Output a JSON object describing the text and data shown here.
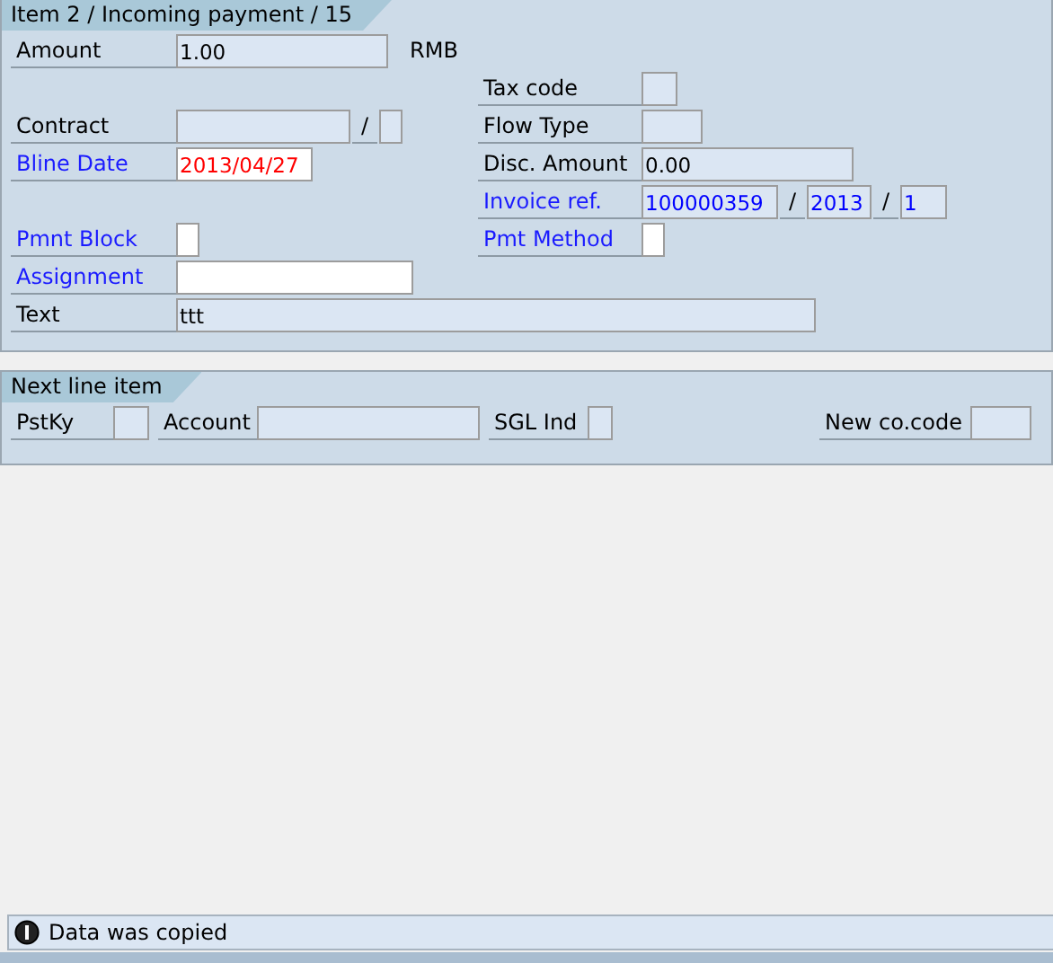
{
  "item_section": {
    "title": "Item 2 / Incoming payment / 15",
    "fields": [
      {
        "label": "Amount",
        "highlighted": false,
        "inputs": [
          {
            "kind": "input",
            "value": "1.00",
            "editable": false,
            "color": "#000000"
          }
        ],
        "unit": "RMB"
      },
      {
        "label": "Tax code",
        "highlighted": false,
        "inputs": [
          {
            "kind": "input",
            "editable": false
          }
        ]
      },
      {
        "label": "Contract",
        "highlighted": false,
        "inputs": [
          {
            "kind": "input",
            "editable": false
          },
          {
            "kind": "separator",
            "text": "/"
          },
          {
            "kind": "input",
            "editable": false
          }
        ]
      },
      {
        "label": "Flow Type",
        "highlighted": false,
        "inputs": [
          {
            "kind": "input",
            "editable": false
          }
        ]
      },
      {
        "label": "Bline Date",
        "highlighted": true,
        "inputs": [
          {
            "kind": "input",
            "value": "2013/04/27",
            "editable": true,
            "color": "#ff0000"
          }
        ]
      },
      {
        "label": "Disc. Amount",
        "highlighted": false,
        "inputs": [
          {
            "kind": "input",
            "value": "0.00",
            "editable": false,
            "color": "#000000"
          }
        ]
      },
      {
        "label": "Invoice ref.",
        "highlighted": true,
        "inputs": [
          {
            "kind": "input",
            "value": "100000359",
            "editable": false,
            "color": "#0000ff"
          },
          {
            "kind": "separator",
            "text": "/"
          },
          {
            "kind": "input",
            "value": "2013",
            "editable": false,
            "color": "#0000ff"
          },
          {
            "kind": "separator",
            "text": "/"
          },
          {
            "kind": "input",
            "value": "1",
            "editable": false,
            "color": "#0000ff"
          }
        ]
      },
      {
        "label": "Pmnt Block",
        "highlighted": true,
        "inputs": [
          {
            "kind": "input",
            "editable": true
          }
        ]
      },
      {
        "label": "Pmt Method",
        "highlighted": true,
        "inputs": [
          {
            "kind": "input",
            "editable": true
          }
        ]
      },
      {
        "label": "Assignment",
        "highlighted": true,
        "inputs": [
          {
            "kind": "input",
            "editable": true
          }
        ]
      },
      {
        "label": "Text",
        "highlighted": false,
        "inputs": [
          {
            "kind": "input",
            "value": "ttt",
            "editable": false,
            "color": "#000000"
          }
        ]
      }
    ]
  },
  "next_line_item": {
    "title": "Next line item",
    "fields": [
      {
        "label": "PstKy",
        "highlighted": false,
        "inputs": [
          {
            "kind": "input",
            "editable": false
          }
        ]
      },
      {
        "label": "Account",
        "highlighted": false,
        "inputs": [
          {
            "kind": "input",
            "editable": false
          }
        ]
      },
      {
        "label": "SGL Ind",
        "highlighted": false,
        "inputs": [
          {
            "kind": "input",
            "editable": false
          }
        ]
      },
      {
        "label": "New co.code",
        "highlighted": false,
        "inputs": [
          {
            "kind": "input",
            "editable": false
          }
        ]
      }
    ]
  },
  "status_bar": {
    "message": "Data was copied"
  }
}
